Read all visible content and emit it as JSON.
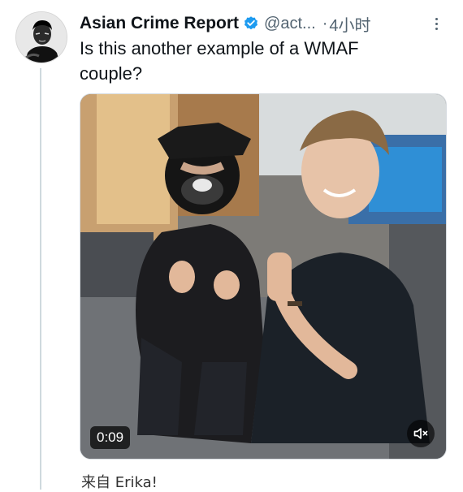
{
  "tweet": {
    "display_name": "Asian Crime Report",
    "handle": "@act...",
    "separator": "·",
    "time": "4小时",
    "text": "Is this another example of a WMAF\ncouple?",
    "verified_color": "#1d9bf0"
  },
  "media": {
    "duration": "0:09"
  },
  "footer": {
    "source": "来自 Erika!"
  },
  "icons": {
    "verified": "verified-badge-icon",
    "more": "more-options-icon",
    "mute": "speaker-muted-icon"
  }
}
